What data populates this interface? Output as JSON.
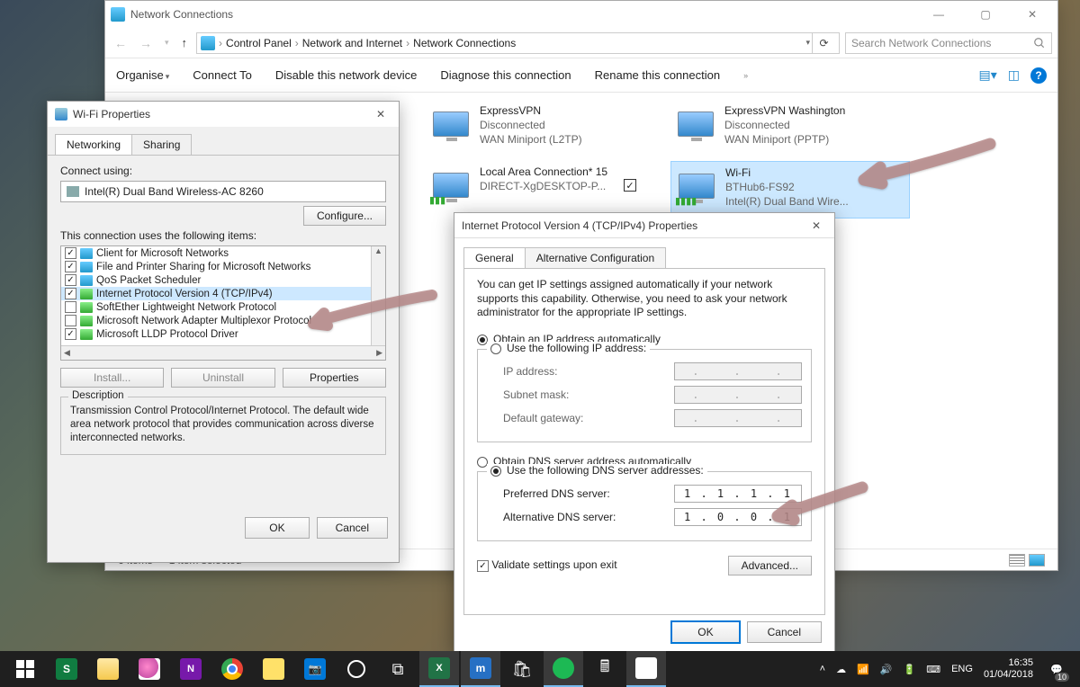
{
  "explorer": {
    "title": "Network Connections",
    "breadcrumb": [
      "Control Panel",
      "Network and Internet",
      "Network Connections"
    ],
    "search_placeholder": "Search Network Connections",
    "toolbar": {
      "organise": "Organise",
      "connect_to": "Connect To",
      "disable": "Disable this network device",
      "diagnose": "Diagnose this connection",
      "rename": "Rename this connection"
    },
    "connections": [
      {
        "name": "ExpressVPN",
        "status": "Disconnected",
        "device": "WAN Miniport (L2TP)",
        "selected": false
      },
      {
        "name": "ExpressVPN Washington",
        "status": "Disconnected",
        "device": "WAN Miniport (PPTP)",
        "selected": false
      },
      {
        "name": "Local Area Connection* 15",
        "status": "",
        "device": "DIRECT-XgDESKTOP-P...",
        "selected": false
      },
      {
        "name": "Wi-Fi",
        "status": "BTHub6-FS92",
        "device": "Intel(R) Dual Band Wire...",
        "selected": true
      }
    ],
    "status": {
      "items": "6 items",
      "selected": "1 item selected"
    }
  },
  "wifi_props": {
    "title": "Wi-Fi Properties",
    "tabs": [
      "Networking",
      "Sharing"
    ],
    "connect_using_label": "Connect using:",
    "adapter": "Intel(R) Dual Band Wireless-AC 8260",
    "configure": "Configure...",
    "items_label": "This connection uses the following items:",
    "items": [
      {
        "checked": true,
        "icon": "b",
        "label": "Client for Microsoft Networks"
      },
      {
        "checked": true,
        "icon": "b",
        "label": "File and Printer Sharing for Microsoft Networks"
      },
      {
        "checked": true,
        "icon": "b",
        "label": "QoS Packet Scheduler"
      },
      {
        "checked": true,
        "icon": "g",
        "label": "Internet Protocol Version 4 (TCP/IPv4)",
        "selected": true
      },
      {
        "checked": false,
        "icon": "g",
        "label": "SoftEther Lightweight Network Protocol"
      },
      {
        "checked": false,
        "icon": "g",
        "label": "Microsoft Network Adapter Multiplexor Protocol"
      },
      {
        "checked": true,
        "icon": "g",
        "label": "Microsoft LLDP Protocol Driver"
      }
    ],
    "install": "Install...",
    "uninstall": "Uninstall",
    "properties": "Properties",
    "description_label": "Description",
    "description": "Transmission Control Protocol/Internet Protocol. The default wide area network protocol that provides communication across diverse interconnected networks.",
    "ok": "OK",
    "cancel": "Cancel"
  },
  "ipv4_props": {
    "title": "Internet Protocol Version 4 (TCP/IPv4) Properties",
    "tabs": [
      "General",
      "Alternative Configuration"
    ],
    "intro": "You can get IP settings assigned automatically if your network supports this capability. Otherwise, you need to ask your network administrator for the appropriate IP settings.",
    "radio_obtain_ip": "Obtain an IP address automatically",
    "radio_use_ip": "Use the following IP address:",
    "ip_label": "IP address:",
    "subnet_label": "Subnet mask:",
    "gateway_label": "Default gateway:",
    "radio_obtain_dns": "Obtain DNS server address automatically",
    "radio_use_dns": "Use the following DNS server addresses:",
    "pref_dns_label": "Preferred DNS server:",
    "alt_dns_label": "Alternative DNS server:",
    "pref_dns": "1  .  1  .  1  .  1",
    "alt_dns": "1  .  0  .  0  .  1",
    "validate": "Validate settings upon exit",
    "advanced": "Advanced...",
    "ok": "OK",
    "cancel": "Cancel"
  },
  "tray": {
    "lang": "ENG",
    "time": "16:35",
    "date": "01/04/2018",
    "notif_count": "10"
  }
}
